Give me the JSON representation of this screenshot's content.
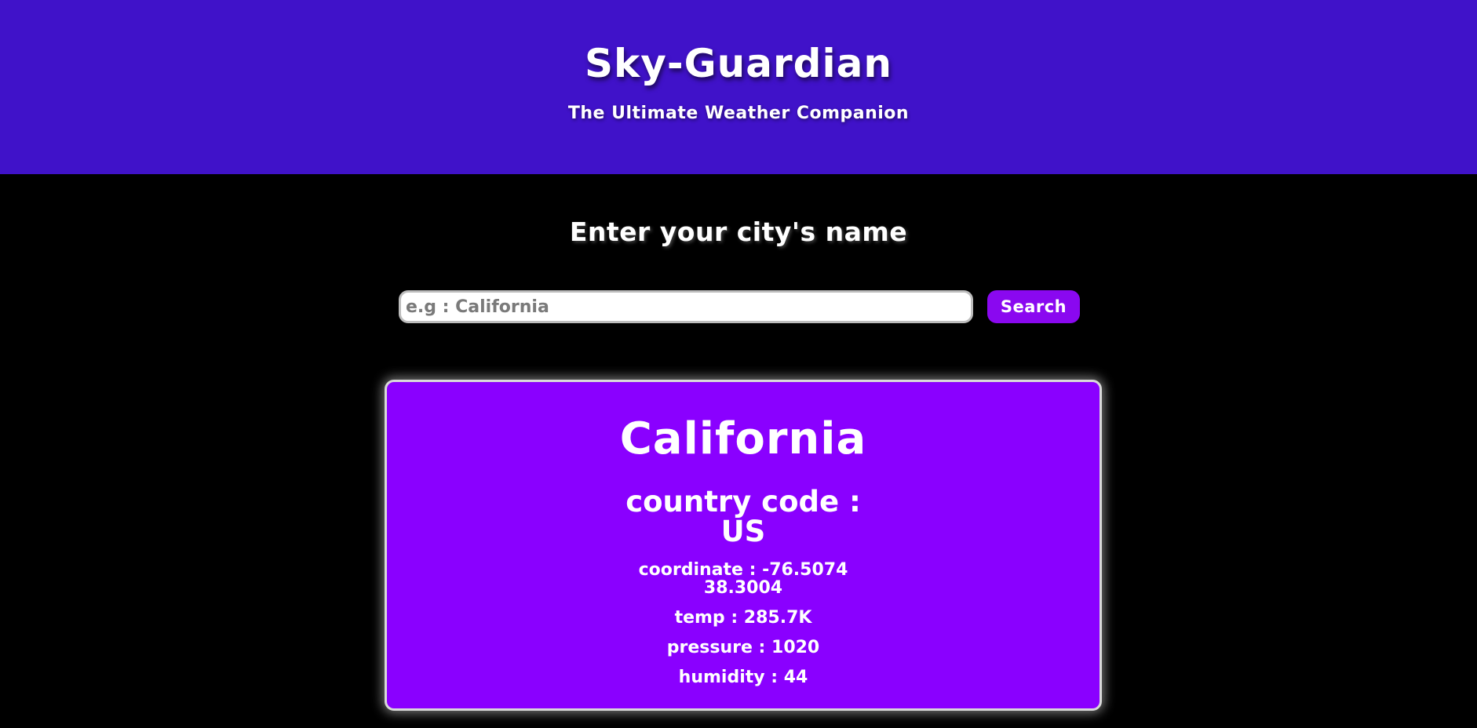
{
  "header": {
    "title": "Sky-Guardian",
    "subtitle": "The Ultimate Weather Companion"
  },
  "search": {
    "prompt": "Enter your city's name",
    "placeholder": "e.g : California",
    "value": "",
    "button_label": "Search"
  },
  "result": {
    "city": "California",
    "country_label": "country code :",
    "country_code": "US",
    "coordinate_line1": "coordinate : -76.5074",
    "coordinate_line2": "38.3004",
    "temp": "temp : 285.7K",
    "pressure": "pressure : 1020",
    "humidity": "humidity : 44"
  },
  "colors": {
    "header_bg": "#4012c9",
    "page_bg": "#000000",
    "accent": "#8a00ff",
    "button_bg": "#8a08f0",
    "text": "#ffffff"
  }
}
